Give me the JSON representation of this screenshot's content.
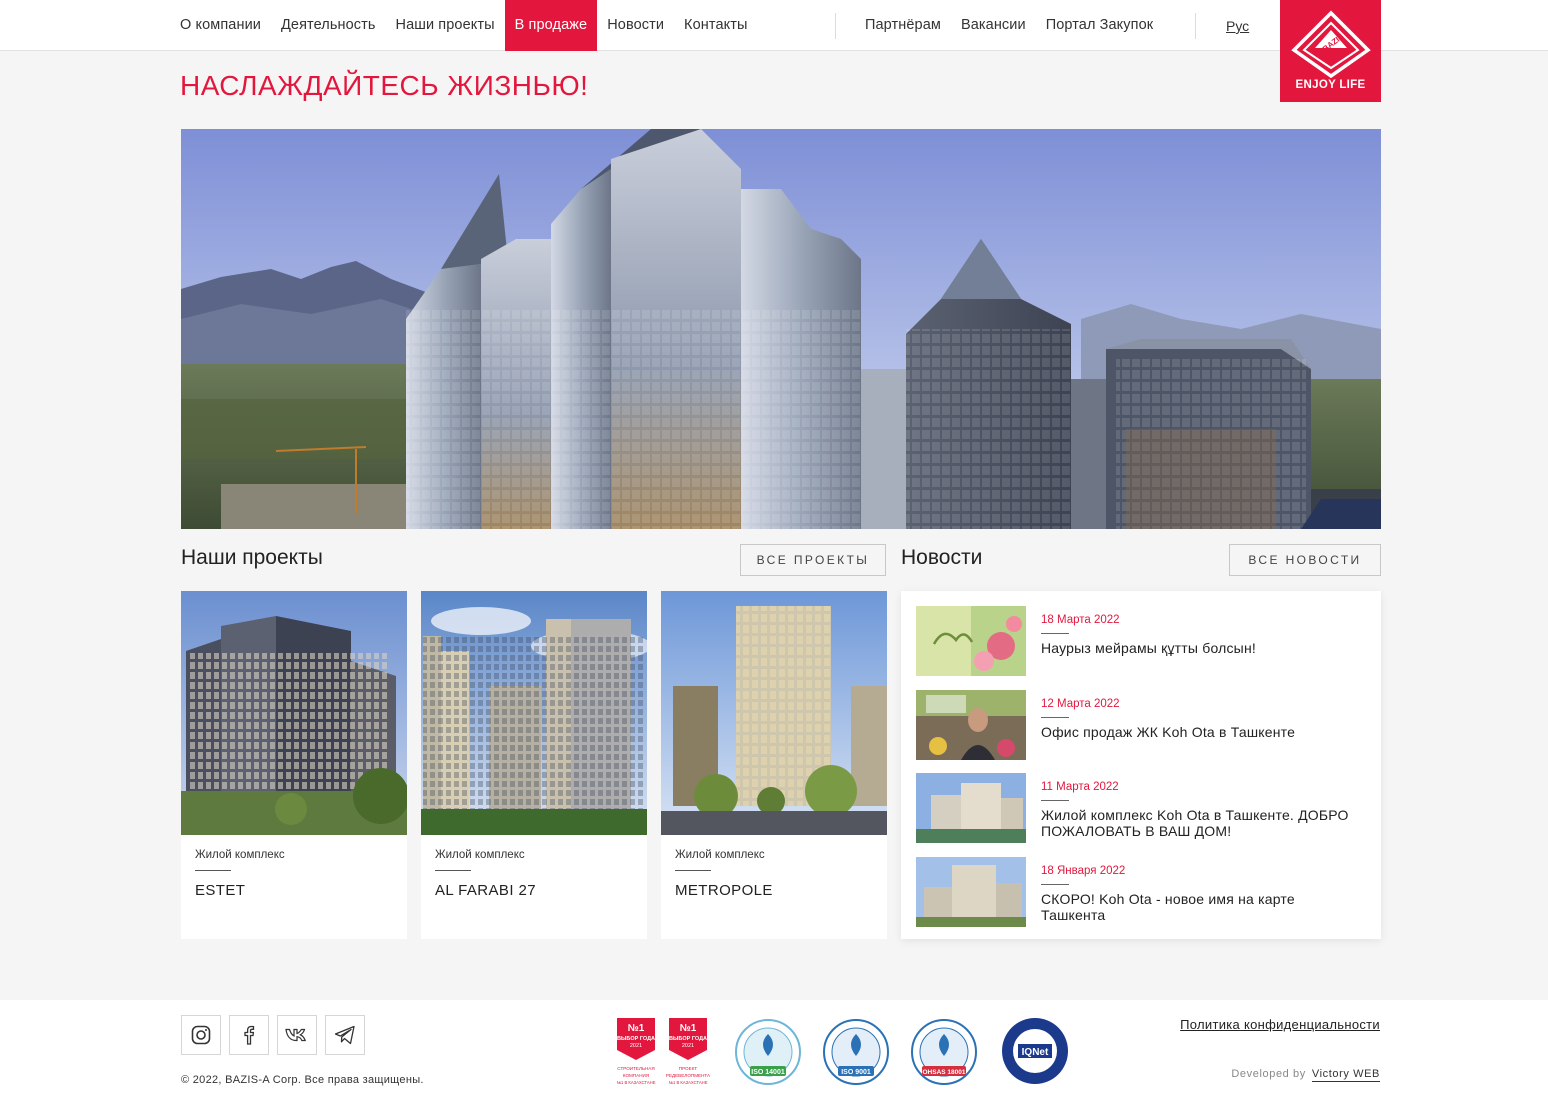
{
  "nav": {
    "main": [
      "О компании",
      "Деятельность",
      "Наши проекты",
      "В продаже",
      "Новости",
      "Контакты"
    ],
    "side": [
      "Партнёрам",
      "Вакансии",
      "Портал Закупок"
    ],
    "lang": "Рус"
  },
  "logo": {
    "mark": "BAZIS",
    "tagline": "ENJOY LIFE"
  },
  "headline": "НАСЛАЖДАЙТЕСЬ ЖИЗНЬЮ!",
  "projects": {
    "title": "Наши проекты",
    "all_button": "ВСЕ ПРОЕКТЫ",
    "items": [
      {
        "kind": "Жилой комплекс",
        "name": "ESTET"
      },
      {
        "kind": "Жилой комплекс",
        "name": "AL FARABI 27"
      },
      {
        "kind": "Жилой комплекс",
        "name": "METROPOLE"
      }
    ]
  },
  "news": {
    "title": "Новости",
    "all_button": "ВСЕ НОВОСТИ",
    "items": [
      {
        "date": "18 Марта 2022",
        "title": "Наурыз мейрамы құтты болсын!"
      },
      {
        "date": "12 Марта 2022",
        "title": "Офис продаж ЖК Koh Ota в Ташкенте"
      },
      {
        "date": "11 Марта 2022",
        "title": "Жилой комплекс Koh Ota в Ташкенте. ДОБРО ПОЖАЛОВАТЬ В ВАШ ДОМ!"
      },
      {
        "date": "18 Января 2022",
        "title": "СКОРО! Koh Ota - новое имя на карте Ташкента"
      }
    ]
  },
  "footer": {
    "social": [
      "instagram-icon",
      "facebook-icon",
      "vk-icon",
      "telegram-icon"
    ],
    "copyright": "© 2022, BAZIS-A Corp. Все права защищены.",
    "badges": [
      {
        "top": "№1",
        "mid": "ВЫБОР ГОДА",
        "year": "2021",
        "caption": "СТРОИТЕЛЬНАЯ КОМПАНИЯ №1 В КАЗАХСТАНЕ"
      },
      {
        "top": "№1",
        "mid": "ВЫБОР ГОДА",
        "year": "2021",
        "caption": "ПРОЕКТ РЕДЕВЕЛОПМЕНТА №1 В КАЗАХСТАНЕ"
      }
    ],
    "certs": [
      "ISO 14001",
      "ISO 9001",
      "OHSAS 18001",
      "IQNet"
    ],
    "policy": "Политика конфиденциальности",
    "developed_by": "Developed by",
    "developer": "Victory WEB"
  },
  "colors": {
    "accent": "#e3173e",
    "background": "#f5f5f5"
  }
}
